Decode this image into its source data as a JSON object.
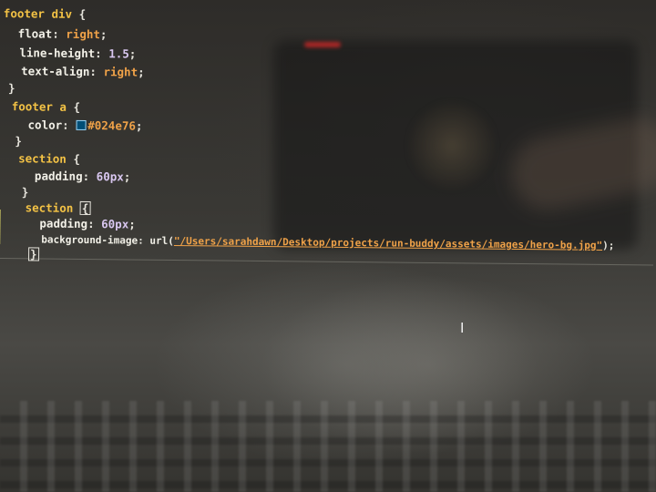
{
  "editor": {
    "lines": [
      {
        "selector": "footer div",
        "open": " {"
      },
      {
        "property": "float",
        "value": "right"
      },
      {
        "property": "line-height",
        "value": "1.5"
      },
      {
        "property": "text-align",
        "value": "right"
      },
      {
        "close": "}"
      },
      {
        "selector": "footer a",
        "open": " {"
      },
      {
        "property": "color",
        "value": "#024e76",
        "swatch": "#024e76"
      },
      {
        "close": "}"
      },
      {
        "selector": "section",
        "open": " {"
      },
      {
        "property": "padding",
        "value": "60px"
      },
      {
        "close": "}"
      },
      {
        "selector": "section",
        "open": "{"
      },
      {
        "property": "padding",
        "value": "60px"
      },
      {
        "property": "background-image",
        "func": "url(",
        "value": "\"/Users/sarahdawn/Desktop/projects/run-buddy/assets/images/hero-bg.jpg\"",
        "end": ");"
      },
      {
        "close": "}"
      }
    ]
  },
  "colors": {
    "selector": "#f3c245",
    "value": "#f0a248",
    "swatch": "#024e76",
    "gutter_modified": "#e9e36a"
  },
  "cursor_icon": "i-beam-cursor-icon"
}
